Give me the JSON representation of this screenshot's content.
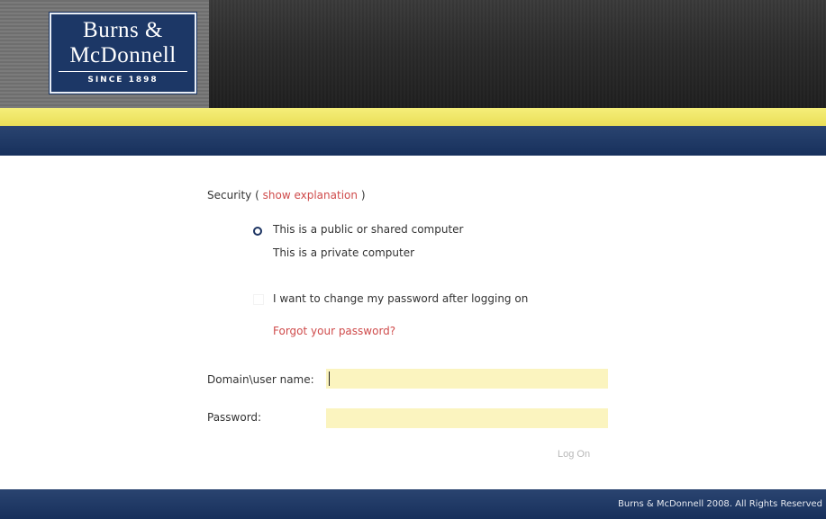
{
  "logo": {
    "line1": "Burns &",
    "line2": "McDonnell",
    "since": "SINCE 1898"
  },
  "security": {
    "label": "Security",
    "paren_open": "(",
    "explanation_link": "show explanation",
    "paren_close": ")",
    "options": [
      {
        "label": "This is a public or shared computer",
        "selected": true
      },
      {
        "label": "This is a private computer",
        "selected": false
      }
    ]
  },
  "change_password": {
    "label": "I want to change my password after logging on",
    "checked": false
  },
  "forgot_password_link": "Forgot your password?",
  "fields": {
    "username_label": "Domain\\user name:",
    "username_value": "",
    "password_label": "Password:",
    "password_value": ""
  },
  "login_button": "Log On",
  "footer": {
    "copyright": "Burns & McDonnell 2008. All Rights Reserved"
  },
  "colors": {
    "navy": "#17305c",
    "yellow_stripe": "#eadf58",
    "field_bg": "#fbf4bf",
    "link": "#cf4b4b"
  }
}
